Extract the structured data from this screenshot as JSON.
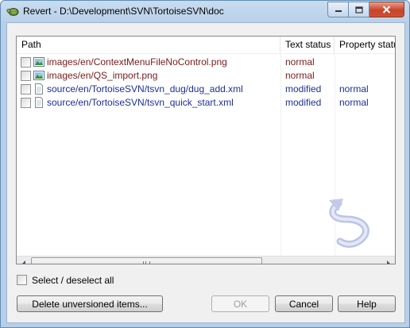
{
  "window": {
    "title": "Revert - D:\\Development\\SVN\\TortoiseSVN\\doc",
    "icon": "tortoisesvn-turtle-icon"
  },
  "list": {
    "columns": [
      "Path",
      "Text status",
      "Property statu"
    ],
    "rows": [
      {
        "path": "images/en/ContextMenuFileNoControl.png",
        "icon": "image-file-icon",
        "text_status": "normal",
        "property_status": ""
      },
      {
        "path": "images/en/QS_import.png",
        "icon": "image-file-icon",
        "text_status": "normal",
        "property_status": ""
      },
      {
        "path": "source/en/TortoiseSVN/tsvn_dug/dug_add.xml",
        "icon": "document-file-icon",
        "text_status": "modified",
        "property_status": "normal"
      },
      {
        "path": "source/en/TortoiseSVN/tsvn_quick_start.xml",
        "icon": "document-file-icon",
        "text_status": "modified",
        "property_status": "normal"
      }
    ],
    "watermark_icon": "revert-arrow-icon"
  },
  "select_all_label": "Select / deselect all",
  "buttons": {
    "delete_unversioned": "Delete unversioned items...",
    "ok": "OK",
    "cancel": "Cancel",
    "help": "Help"
  },
  "colors": {
    "status_normal": "#7a1a1a",
    "status_modified": "#1c2f9c",
    "titlebar": "#b7cfe8"
  }
}
